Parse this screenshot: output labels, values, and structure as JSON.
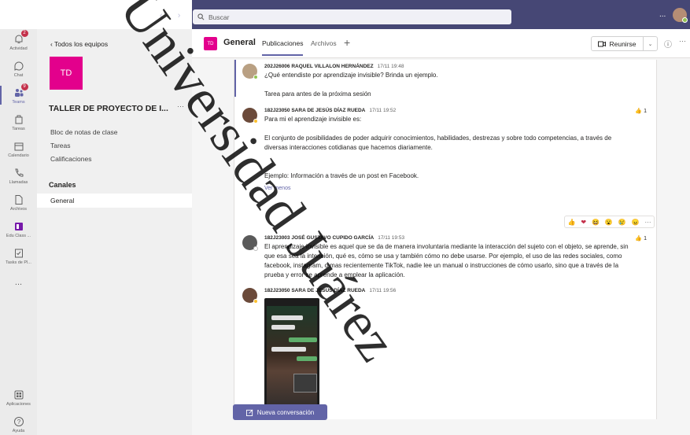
{
  "topbar": {
    "search_placeholder": "Buscar",
    "more": "...",
    "back_forward": "‹ ›"
  },
  "rail": {
    "items": [
      {
        "label": "Actividad",
        "badge": "2"
      },
      {
        "label": "Chat"
      },
      {
        "label": "Teams",
        "badge": "9"
      },
      {
        "label": "Tareas"
      },
      {
        "label": "Calendario"
      },
      {
        "label": "Llamadas"
      },
      {
        "label": "Archivos"
      },
      {
        "label": "Edu Class ..."
      },
      {
        "label": "Tasks de Pl..."
      },
      {
        "label": "..."
      }
    ],
    "bottom": [
      {
        "label": "Aplicaciones"
      },
      {
        "label": "Ayuda"
      }
    ]
  },
  "panel": {
    "back_label": "Todos los equipos",
    "team_initials": "TD",
    "team_name": "TALLER DE PROYECTO DE I...",
    "team_more": "···",
    "links": [
      "Bloc de notas de clase",
      "Tareas",
      "Calificaciones"
    ],
    "channels_heading": "Canales",
    "channel": "General"
  },
  "header": {
    "tile": "TD",
    "channel_name": "General",
    "tabs": [
      "Publicaciones",
      "Archivos"
    ],
    "add_tab": "+",
    "meet_label": "Reunirse",
    "meet_drop": "⌄",
    "info": "ⓘ",
    "more": "···"
  },
  "posts": [
    {
      "author": "202J26006 RAQUEL VILLALON HERNÁNDEZ",
      "time": "17/11 19:48",
      "lines": [
        "¿Qué entendiste por aprendizaje invisible? Brinda un ejemplo.",
        "",
        "Tarea para antes de la próxima sesión"
      ]
    },
    {
      "author": "182J23050 SARA DE JESÚS DÍAZ RUEDA",
      "time": "17/11 19:52",
      "likes": "1",
      "lines": [
        "Para mi el aprendizaje invisible es:",
        "",
        "El conjunto de posibilidades de poder adquirir conocimientos, habilidades, destrezas y sobre todo competencias, a través de",
        "diversas interacciones cotidianas que hacemos diariamente.",
        "",
        "",
        "Ejemplo: Información a través de un post en Facebook."
      ],
      "see_less": "Ver menos"
    },
    {
      "author": "182J23003 JOSÉ GUSTAVO CUPIDO GARCÍA",
      "time": "17/11 19:53",
      "likes": "1",
      "lines": [
        "El aprendizaje invisible es aquel que se da de manera involuntaria mediante la interacción del sujeto con el objeto, se aprende, sin",
        "que esa sea la intención, qué es, cómo se usa y también cómo no debe usarse. Por ejemplo, el uso de las redes sociales, como",
        "facebook, instagram, o mas recientemente TikTok, nadie lee un manual o instrucciones de cómo usarlo, sino que a través de la",
        "prueba y error se aprende a emplear la aplicación."
      ]
    },
    {
      "author": "182J23050 SARA DE JESÚS DÍAZ RUEDA",
      "time": "17/11 19:56"
    }
  ],
  "reactions": [
    "👍",
    "❤",
    "😆",
    "😮",
    "😢",
    "😠",
    "···"
  ],
  "new_conversation": "Nueva conversación",
  "watermark": "Universidad Juárez",
  "colors": {
    "accent": "#6264a7",
    "topbar": "#464775",
    "team_tile": "#e3008c"
  }
}
